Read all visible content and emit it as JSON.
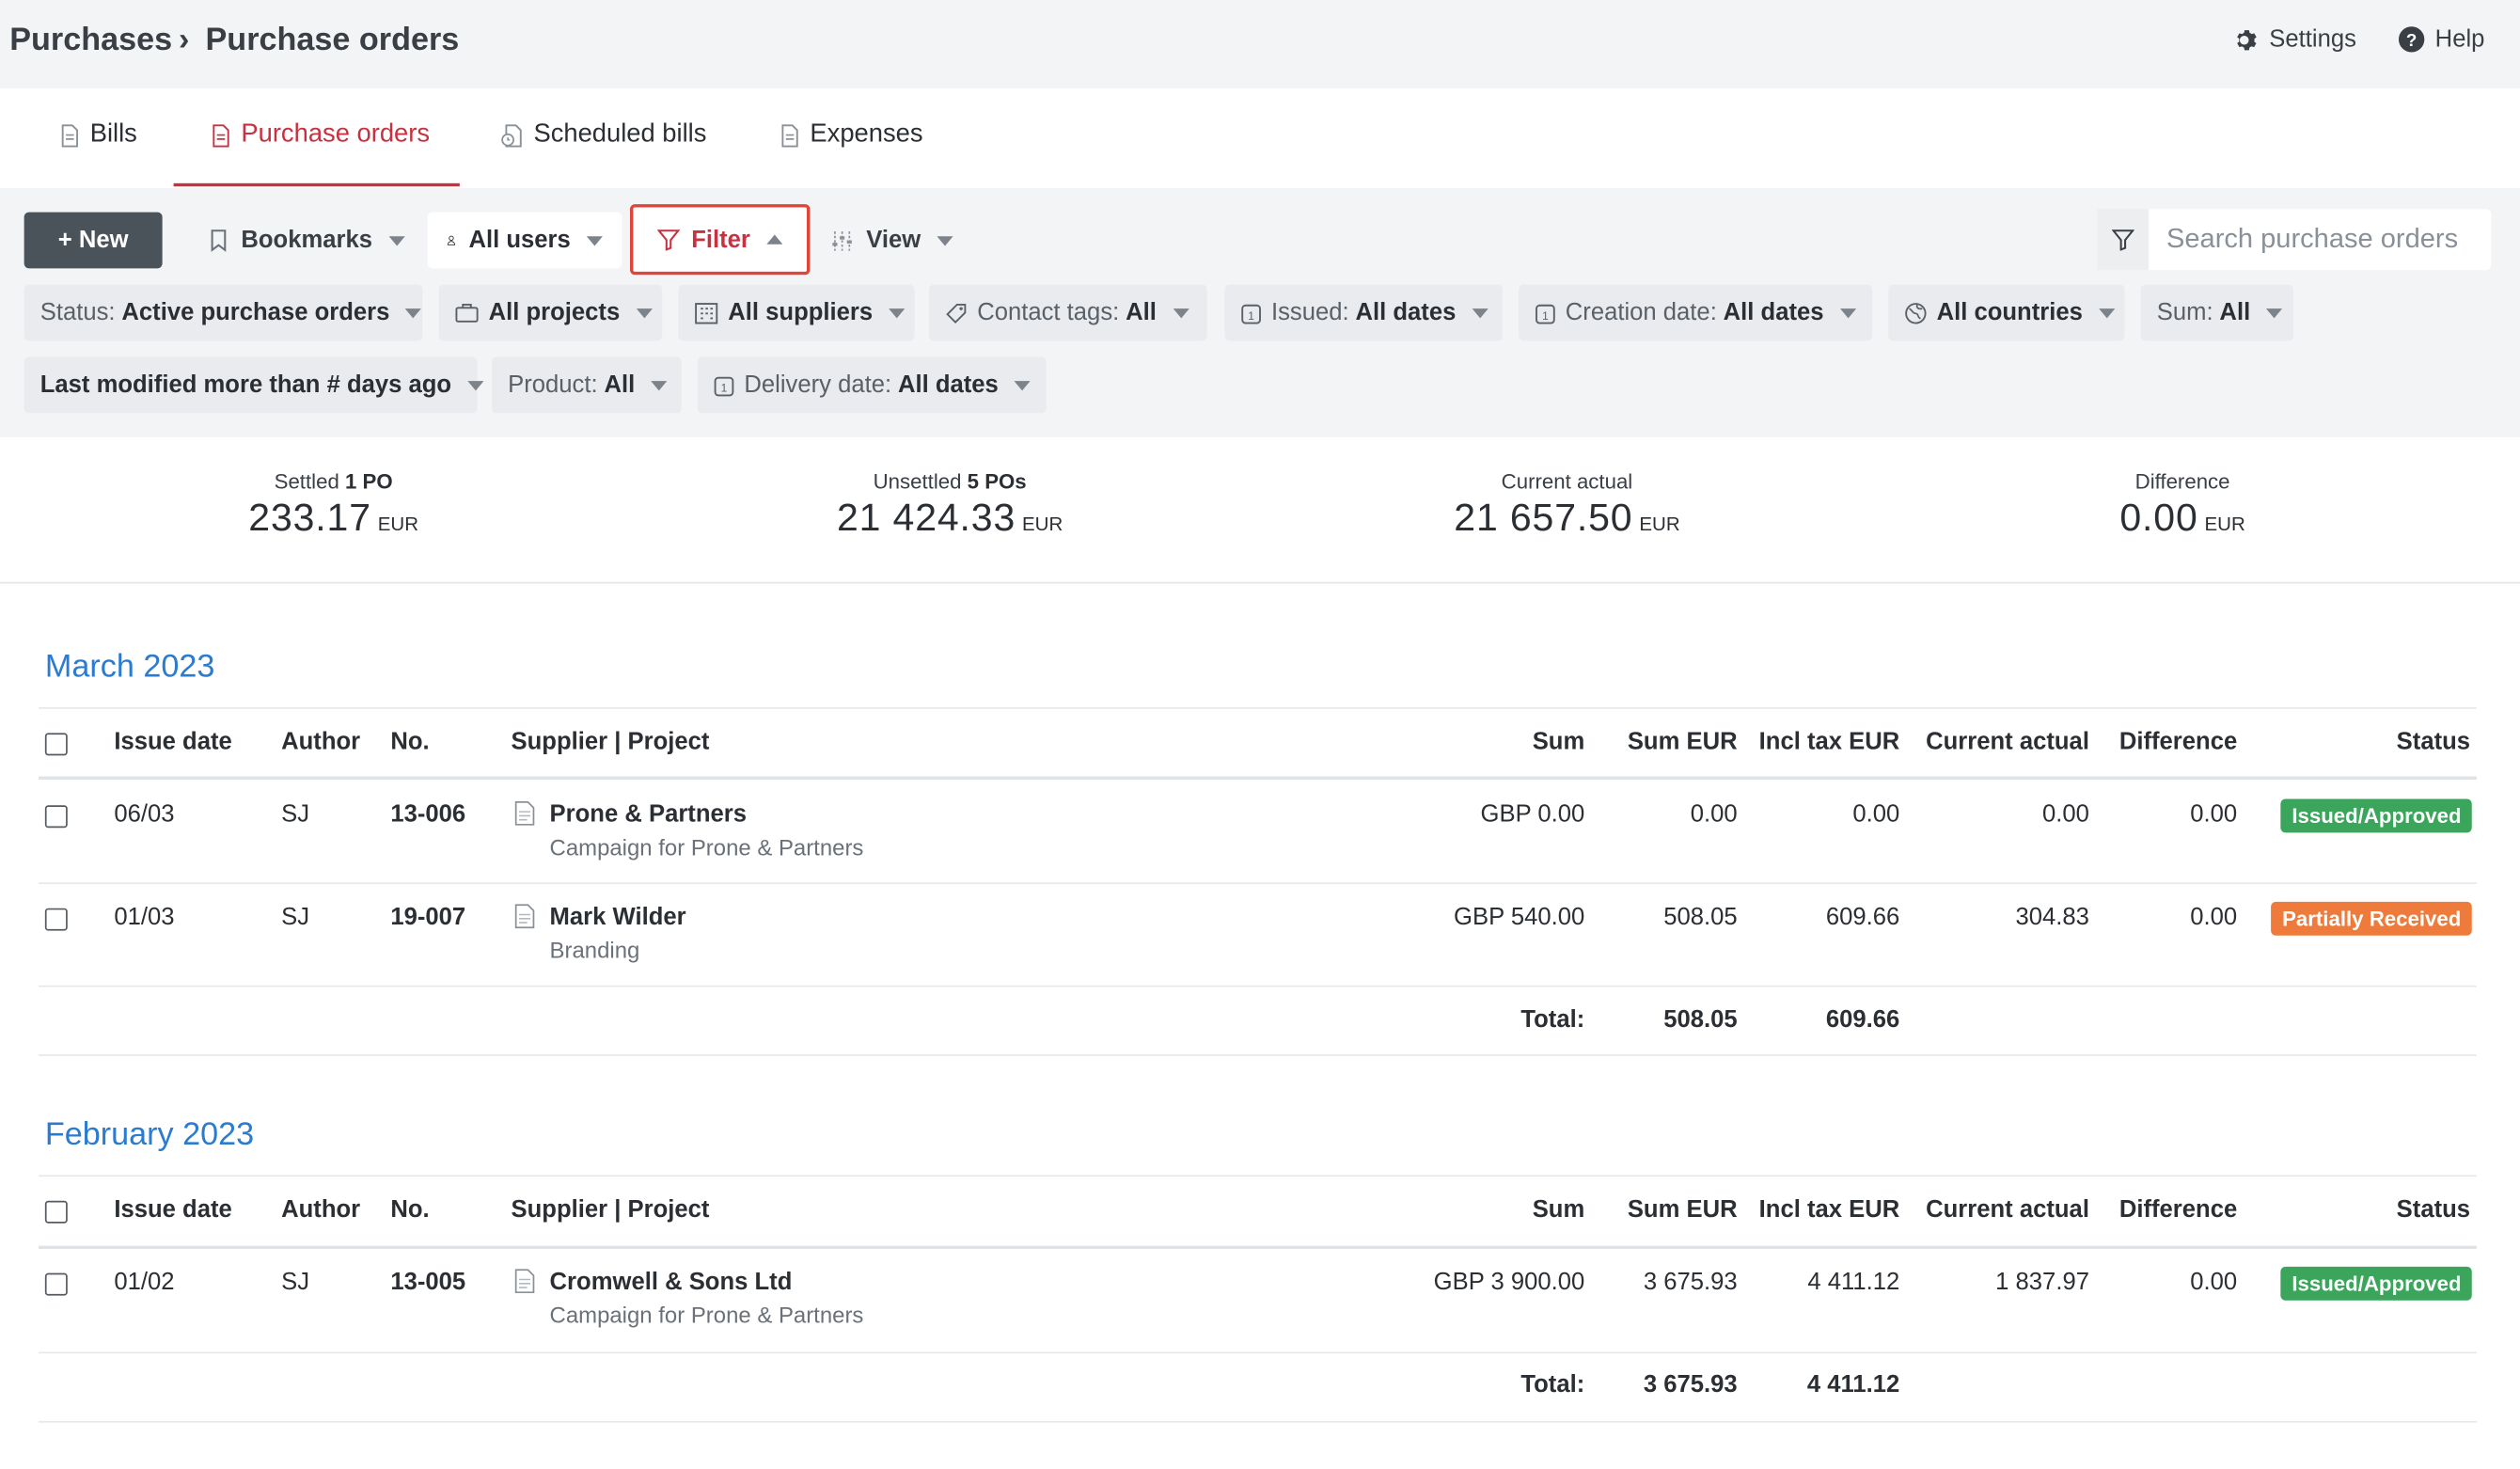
{
  "breadcrumb": {
    "parent": "Purchases",
    "separator": "›",
    "current": "Purchase orders"
  },
  "top_actions": {
    "settings": "Settings",
    "help": "Help"
  },
  "tabs": [
    {
      "label": "Bills",
      "icon": "document-icon"
    },
    {
      "label": "Purchase orders",
      "icon": "document-icon",
      "active": true
    },
    {
      "label": "Scheduled bills",
      "icon": "document-clock-icon"
    },
    {
      "label": "Expenses",
      "icon": "document-icon"
    }
  ],
  "toolbar": {
    "new_label": "+ New",
    "bookmarks_label": "Bookmarks",
    "all_users_label": "All users",
    "filter_label": "Filter",
    "view_label": "View",
    "search_placeholder": "Search purchase orders"
  },
  "chips": {
    "status": {
      "prefix": "Status:",
      "value": "Active purchase orders"
    },
    "projects": {
      "value": "All projects"
    },
    "suppliers": {
      "value": "All suppliers"
    },
    "contact_tags": {
      "prefix": "Contact tags:",
      "value": "All"
    },
    "issued": {
      "prefix": "Issued:",
      "value": "All dates"
    },
    "creation_date": {
      "prefix": "Creation date:",
      "value": "All dates"
    },
    "countries": {
      "value": "All countries"
    },
    "sum": {
      "prefix": "Sum:",
      "value": "All"
    },
    "last_modified": {
      "value": "Last modified more than # days ago"
    },
    "product": {
      "prefix": "Product:",
      "value": "All"
    },
    "delivery_date": {
      "prefix": "Delivery date:",
      "value": "All dates"
    }
  },
  "summary": {
    "settled": {
      "label": "Settled",
      "count": "1 PO",
      "value": "233.17",
      "currency": "EUR"
    },
    "unsettled": {
      "label": "Unsettled",
      "count": "5 POs",
      "value": "21 424.33",
      "currency": "EUR"
    },
    "current_actual": {
      "label": "Current actual",
      "value": "21 657.50",
      "currency": "EUR"
    },
    "difference": {
      "label": "Difference",
      "value": "0.00",
      "currency": "EUR"
    }
  },
  "columns": {
    "issue_date": "Issue date",
    "author": "Author",
    "no": "No.",
    "supplier_project": "Supplier | Project",
    "sum": "Sum",
    "sum_eur": "Sum EUR",
    "incl_tax_eur": "Incl tax EUR",
    "current_actual": "Current actual",
    "difference": "Difference",
    "status": "Status"
  },
  "groups": [
    {
      "title": "March 2023",
      "rows": [
        {
          "issue_date": "06/03",
          "author": "SJ",
          "no": "13-006",
          "supplier": "Prone & Partners",
          "project": "Campaign for Prone & Partners",
          "sum": "GBP 0.00",
          "sum_eur": "0.00",
          "incl_tax_eur": "0.00",
          "current_actual": "0.00",
          "difference": "0.00",
          "status": "Issued/Approved"
        },
        {
          "issue_date": "01/03",
          "author": "SJ",
          "no": "19-007",
          "supplier": "Mark Wilder",
          "project": "Branding",
          "sum": "GBP 540.00",
          "sum_eur": "508.05",
          "incl_tax_eur": "609.66",
          "current_actual": "304.83",
          "difference": "0.00",
          "status": "Partially Received"
        }
      ],
      "total_label": "Total:",
      "total_sum_eur": "508.05",
      "total_incl_tax_eur": "609.66"
    },
    {
      "title": "February 2023",
      "rows": [
        {
          "issue_date": "01/02",
          "author": "SJ",
          "no": "13-005",
          "supplier": "Cromwell & Sons Ltd",
          "project": "Campaign for Prone & Partners",
          "sum": "GBP 3 900.00",
          "sum_eur": "3 675.93",
          "incl_tax_eur": "4 411.12",
          "current_actual": "1 837.97",
          "difference": "0.00",
          "status": "Issued/Approved"
        }
      ],
      "total_label": "Total:",
      "total_sum_eur": "3 675.93",
      "total_incl_tax_eur": "4 411.12"
    }
  ],
  "colors": {
    "accent": "#c8313f",
    "link": "#2b7bd0",
    "badge_green": "#3aa55b",
    "badge_orange": "#ee7b3c",
    "filter_outline": "#e0453a"
  }
}
